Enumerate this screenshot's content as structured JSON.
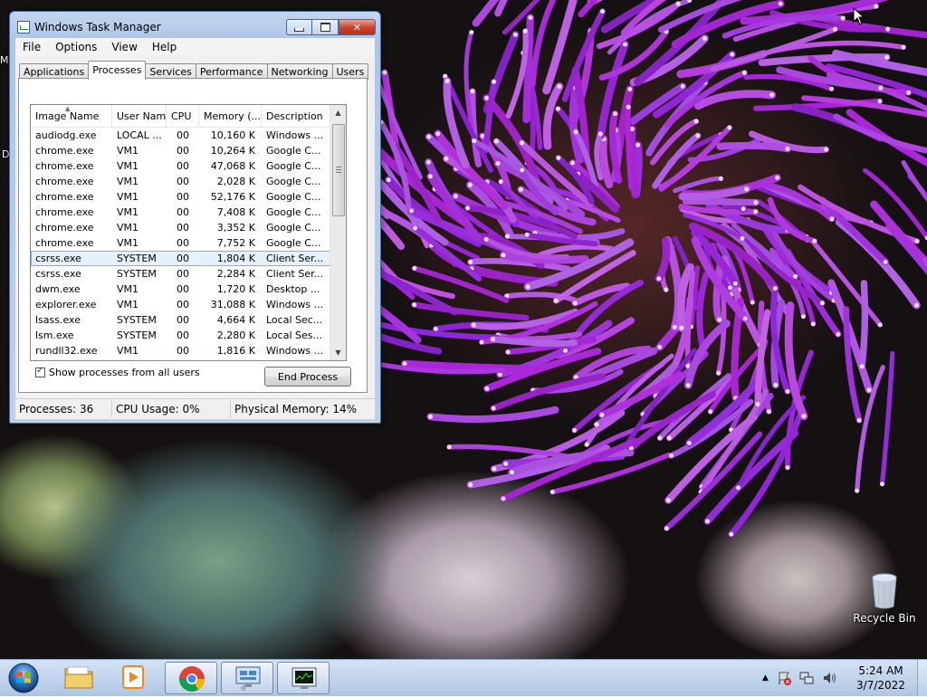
{
  "window": {
    "title": "Windows Task Manager",
    "close_label": "✕"
  },
  "menu": [
    "File",
    "Options",
    "View",
    "Help"
  ],
  "tabs": [
    "Applications",
    "Processes",
    "Services",
    "Performance",
    "Networking",
    "Users"
  ],
  "active_tab": "Processes",
  "columns": [
    "Image Name",
    "User Name",
    "CPU",
    "Memory (...",
    "Description"
  ],
  "processes": [
    {
      "image": "audiodg.exe",
      "user": "LOCAL ...",
      "cpu": "00",
      "memory": "10,160 K",
      "desc": "Windows ..."
    },
    {
      "image": "chrome.exe",
      "user": "VM1",
      "cpu": "00",
      "memory": "10,264 K",
      "desc": "Google C..."
    },
    {
      "image": "chrome.exe",
      "user": "VM1",
      "cpu": "00",
      "memory": "47,068 K",
      "desc": "Google C..."
    },
    {
      "image": "chrome.exe",
      "user": "VM1",
      "cpu": "00",
      "memory": "2,028 K",
      "desc": "Google C..."
    },
    {
      "image": "chrome.exe",
      "user": "VM1",
      "cpu": "00",
      "memory": "52,176 K",
      "desc": "Google C..."
    },
    {
      "image": "chrome.exe",
      "user": "VM1",
      "cpu": "00",
      "memory": "7,408 K",
      "desc": "Google C..."
    },
    {
      "image": "chrome.exe",
      "user": "VM1",
      "cpu": "00",
      "memory": "3,352 K",
      "desc": "Google C..."
    },
    {
      "image": "chrome.exe",
      "user": "VM1",
      "cpu": "00",
      "memory": "7,752 K",
      "desc": "Google C..."
    },
    {
      "image": "csrss.exe",
      "user": "SYSTEM",
      "cpu": "00",
      "memory": "1,804 K",
      "desc": "Client Ser...",
      "selected": true
    },
    {
      "image": "csrss.exe",
      "user": "SYSTEM",
      "cpu": "00",
      "memory": "2,284 K",
      "desc": "Client Ser..."
    },
    {
      "image": "dwm.exe",
      "user": "VM1",
      "cpu": "00",
      "memory": "1,720 K",
      "desc": "Desktop ..."
    },
    {
      "image": "explorer.exe",
      "user": "VM1",
      "cpu": "00",
      "memory": "31,088 K",
      "desc": "Windows ..."
    },
    {
      "image": "lsass.exe",
      "user": "SYSTEM",
      "cpu": "00",
      "memory": "4,664 K",
      "desc": "Local Sec..."
    },
    {
      "image": "lsm.exe",
      "user": "SYSTEM",
      "cpu": "00",
      "memory": "2,280 K",
      "desc": "Local Ses..."
    },
    {
      "image": "rundll32.exe",
      "user": "VM1",
      "cpu": "00",
      "memory": "1,816 K",
      "desc": "Windows ..."
    }
  ],
  "show_all": {
    "label": "Show processes from all users",
    "checked": true
  },
  "end_process_label": "End Process",
  "status": {
    "processes": "Processes: 36",
    "cpu": "CPU Usage: 0%",
    "memory": "Physical Memory: 14%"
  },
  "desktop": {
    "recycle_bin_label": "Recycle Bin",
    "edge_text_1": "M",
    "edge_text_2": "D"
  },
  "taskbar": {
    "items": [
      {
        "name": "windows-explorer",
        "icon": "folder-icon",
        "open": false
      },
      {
        "name": "media-player",
        "icon": "media-player-icon",
        "open": false
      },
      {
        "name": "google-chrome",
        "icon": "chrome-icon",
        "open": true
      },
      {
        "name": "control-panel",
        "icon": "monitor-settings-icon",
        "open": true
      },
      {
        "name": "task-manager",
        "icon": "task-manager-icon",
        "open": true
      }
    ],
    "clock_time": "5:24 AM",
    "clock_date": "3/7/2022",
    "tray_chevron": "▲"
  },
  "colors": {
    "selection_bg": "#e5f1fb",
    "close_button": "#c9402a",
    "title_bar": "#aec6e6"
  }
}
